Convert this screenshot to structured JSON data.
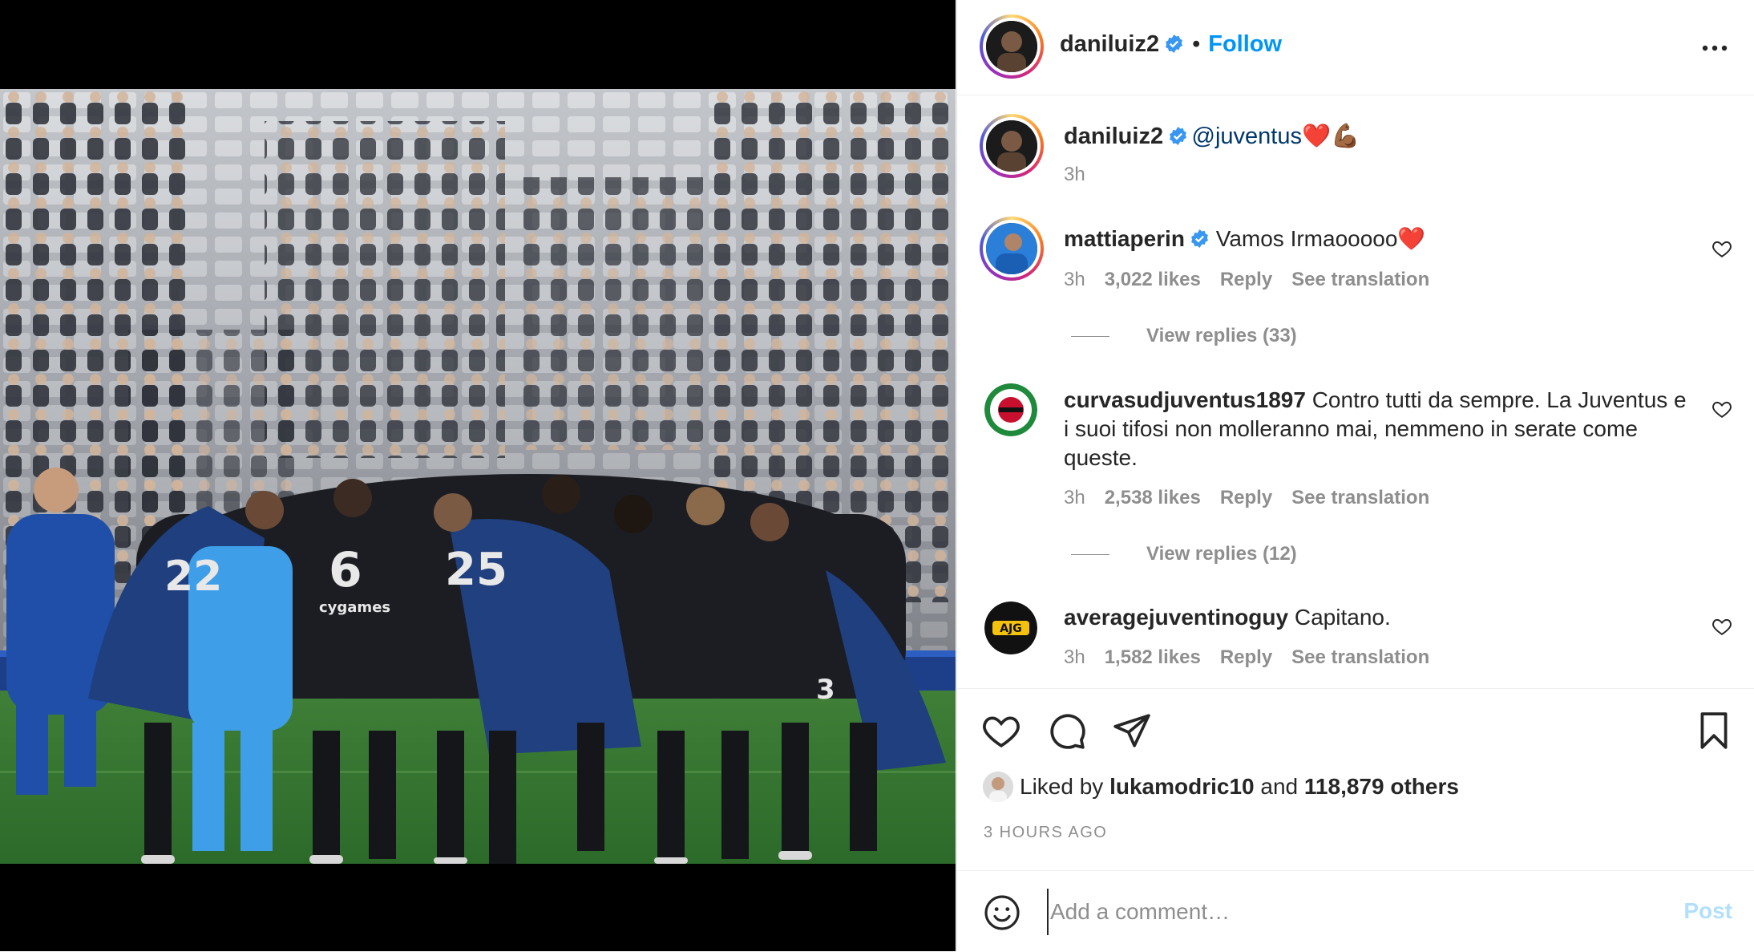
{
  "post": {
    "author": "daniluiz2",
    "follow_label": "Follow",
    "separator": "•",
    "caption": {
      "username": "daniluiz2",
      "mention": "@juventus",
      "emoji": "❤️💪🏾",
      "time": "3h"
    }
  },
  "comments": [
    {
      "username": "mattiaperin",
      "verified": true,
      "text": "Vamos Irmaooooo❤️",
      "time": "3h",
      "likes": "3,022 likes",
      "reply": "Reply",
      "translate": "See translation",
      "view_replies": "View replies (33)"
    },
    {
      "username": "curvasudjuventus1897",
      "verified": false,
      "text": "Contro tutti da sempre. La Juventus e i suoi tifosi non molleranno mai, nemmeno in serate come queste.",
      "time": "3h",
      "likes": "2,538 likes",
      "reply": "Reply",
      "translate": "See translation",
      "view_replies": "View replies (12)"
    },
    {
      "username": "averagejuventinoguy",
      "verified": false,
      "text": "Capitano.",
      "time": "3h",
      "likes": "1,582 likes",
      "reply": "Reply",
      "translate": "See translation",
      "badge_text": "AJG"
    }
  ],
  "likes": {
    "prefix": "Liked by",
    "user": "lukamodric10",
    "middle": "and",
    "others": "118,879 others"
  },
  "time_ago": "3 HOURS AGO",
  "comment_box": {
    "placeholder": "Add a comment…",
    "post_label": "Post"
  },
  "photo": {
    "jersey_numbers": [
      "22",
      "6",
      "25",
      "3"
    ],
    "sponsor": "cygames"
  },
  "colors": {
    "accent": "#0095f6",
    "verified": "#3897f0",
    "post_disabled": "#b2dffc",
    "muted": "#8e8e8e"
  },
  "icons": [
    "more-icon",
    "verified-icon",
    "heart-icon",
    "comment-icon",
    "share-icon",
    "bookmark-icon",
    "emoji-icon"
  ]
}
